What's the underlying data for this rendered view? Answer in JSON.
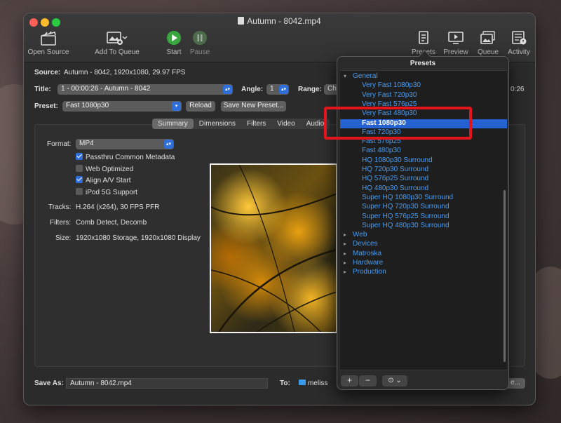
{
  "window": {
    "title": "Autumn - 8042.mp4"
  },
  "toolbar": {
    "open_source": "Open Source",
    "add_to_queue": "Add To Queue",
    "start": "Start",
    "pause": "Pause",
    "presets": "Presets",
    "preview": "Preview",
    "queue": "Queue",
    "activity": "Activity"
  },
  "source": {
    "label": "Source:",
    "value": "Autumn - 8042, 1920x1080, 29.97 FPS"
  },
  "title_row": {
    "label": "Title:",
    "value": "1 - 00:00:26 - Autumn - 8042",
    "angle_label": "Angle:",
    "angle_value": "1",
    "range_label": "Range:",
    "range_value": "Ch",
    "range_end": "0:26"
  },
  "preset_row": {
    "label": "Preset:",
    "value": "Fast 1080p30",
    "reload": "Reload",
    "save_new": "Save New Preset..."
  },
  "tabs": [
    "Summary",
    "Dimensions",
    "Filters",
    "Video",
    "Audio"
  ],
  "summary": {
    "format_label": "Format:",
    "format_value": "MP4",
    "options": [
      {
        "label": "Passthru Common Metadata",
        "checked": true
      },
      {
        "label": "Web Optimized",
        "checked": false
      },
      {
        "label": "Align A/V Start",
        "checked": true
      },
      {
        "label": "iPod 5G Support",
        "checked": false
      }
    ],
    "tracks_label": "Tracks:",
    "tracks_value": "H.264 (x264), 30 FPS PFR",
    "filters_label": "Filters:",
    "filters_value": "Comb Detect, Decomb",
    "size_label": "Size:",
    "size_value": "1920x1080 Storage, 1920x1080 Display"
  },
  "bottom": {
    "save_as_label": "Save As:",
    "save_as_value": "Autumn - 8042.mp4",
    "to_label": "To:",
    "to_value": "meliss",
    "browse_suffix": "e..."
  },
  "presets_panel": {
    "title": "Presets",
    "rows": [
      {
        "text": "General",
        "kind": "group",
        "expanded": true
      },
      {
        "text": "Very Fast 1080p30",
        "kind": "item"
      },
      {
        "text": "Very Fast 720p30",
        "kind": "item"
      },
      {
        "text": "Very Fast 576p25",
        "kind": "item"
      },
      {
        "text": "Very Fast 480p30",
        "kind": "item"
      },
      {
        "text": "Fast 1080p30",
        "kind": "item",
        "selected": true
      },
      {
        "text": "Fast 720p30",
        "kind": "item"
      },
      {
        "text": "Fast 576p25",
        "kind": "item"
      },
      {
        "text": "Fast 480p30",
        "kind": "item"
      },
      {
        "text": "HQ 1080p30 Surround",
        "kind": "item"
      },
      {
        "text": "HQ 720p30 Surround",
        "kind": "item"
      },
      {
        "text": "HQ 576p25 Surround",
        "kind": "item"
      },
      {
        "text": "HQ 480p30 Surround",
        "kind": "item"
      },
      {
        "text": "Super HQ 1080p30 Surround",
        "kind": "item"
      },
      {
        "text": "Super HQ 720p30 Surround",
        "kind": "item"
      },
      {
        "text": "Super HQ 576p25 Surround",
        "kind": "item"
      },
      {
        "text": "Super HQ 480p30 Surround",
        "kind": "item"
      },
      {
        "text": "Web",
        "kind": "group",
        "expanded": false
      },
      {
        "text": "Devices",
        "kind": "group",
        "expanded": false
      },
      {
        "text": "Matroska",
        "kind": "group",
        "expanded": false
      },
      {
        "text": "Hardware",
        "kind": "group",
        "expanded": false
      },
      {
        "text": "Production",
        "kind": "group",
        "expanded": false
      }
    ],
    "add_button": "+",
    "remove_button": "−",
    "more_button": "⊙ ⌄"
  },
  "colors": {
    "accent": "#2462d2",
    "link": "#4a9cf0",
    "highlight": "#e3141c"
  }
}
